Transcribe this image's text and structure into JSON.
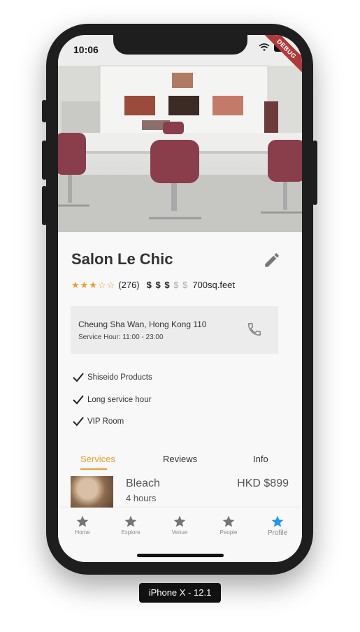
{
  "device_caption": "iPhone X - 12.1",
  "status_bar": {
    "time": "10:06",
    "debug_label": "DEBUG"
  },
  "salon": {
    "name": "Salon Le Chic",
    "rating_count": "(276)",
    "rating_stars": 3,
    "price_level": 3,
    "price_max": 5,
    "price_symbol": "$",
    "area": "700sq.feet",
    "address": "Cheung Sha Wan, Hong Kong 110",
    "service_hours": "Service Hour: 11:00 - 23:00"
  },
  "features": [
    "Shiseido Products",
    "Long service hour",
    "VIP Room"
  ],
  "tabs": [
    {
      "label": "Services",
      "active": true
    },
    {
      "label": "Reviews",
      "active": false
    },
    {
      "label": "Info",
      "active": false
    }
  ],
  "services": [
    {
      "name": "Bleach",
      "duration": "4 hours",
      "price": "HKD $899"
    }
  ],
  "bottom_nav": [
    {
      "label": "Home",
      "icon": "star-icon",
      "active": false
    },
    {
      "label": "Explore",
      "icon": "star-icon",
      "active": false
    },
    {
      "label": "Venue",
      "icon": "star-icon",
      "active": false
    },
    {
      "label": "People",
      "icon": "star-icon",
      "active": false
    },
    {
      "label": "Profile",
      "icon": "star-icon",
      "active": true
    }
  ],
  "colors": {
    "accent": "#f39a2b",
    "active_nav": "#2196f3",
    "inactive_nav": "#757575"
  }
}
